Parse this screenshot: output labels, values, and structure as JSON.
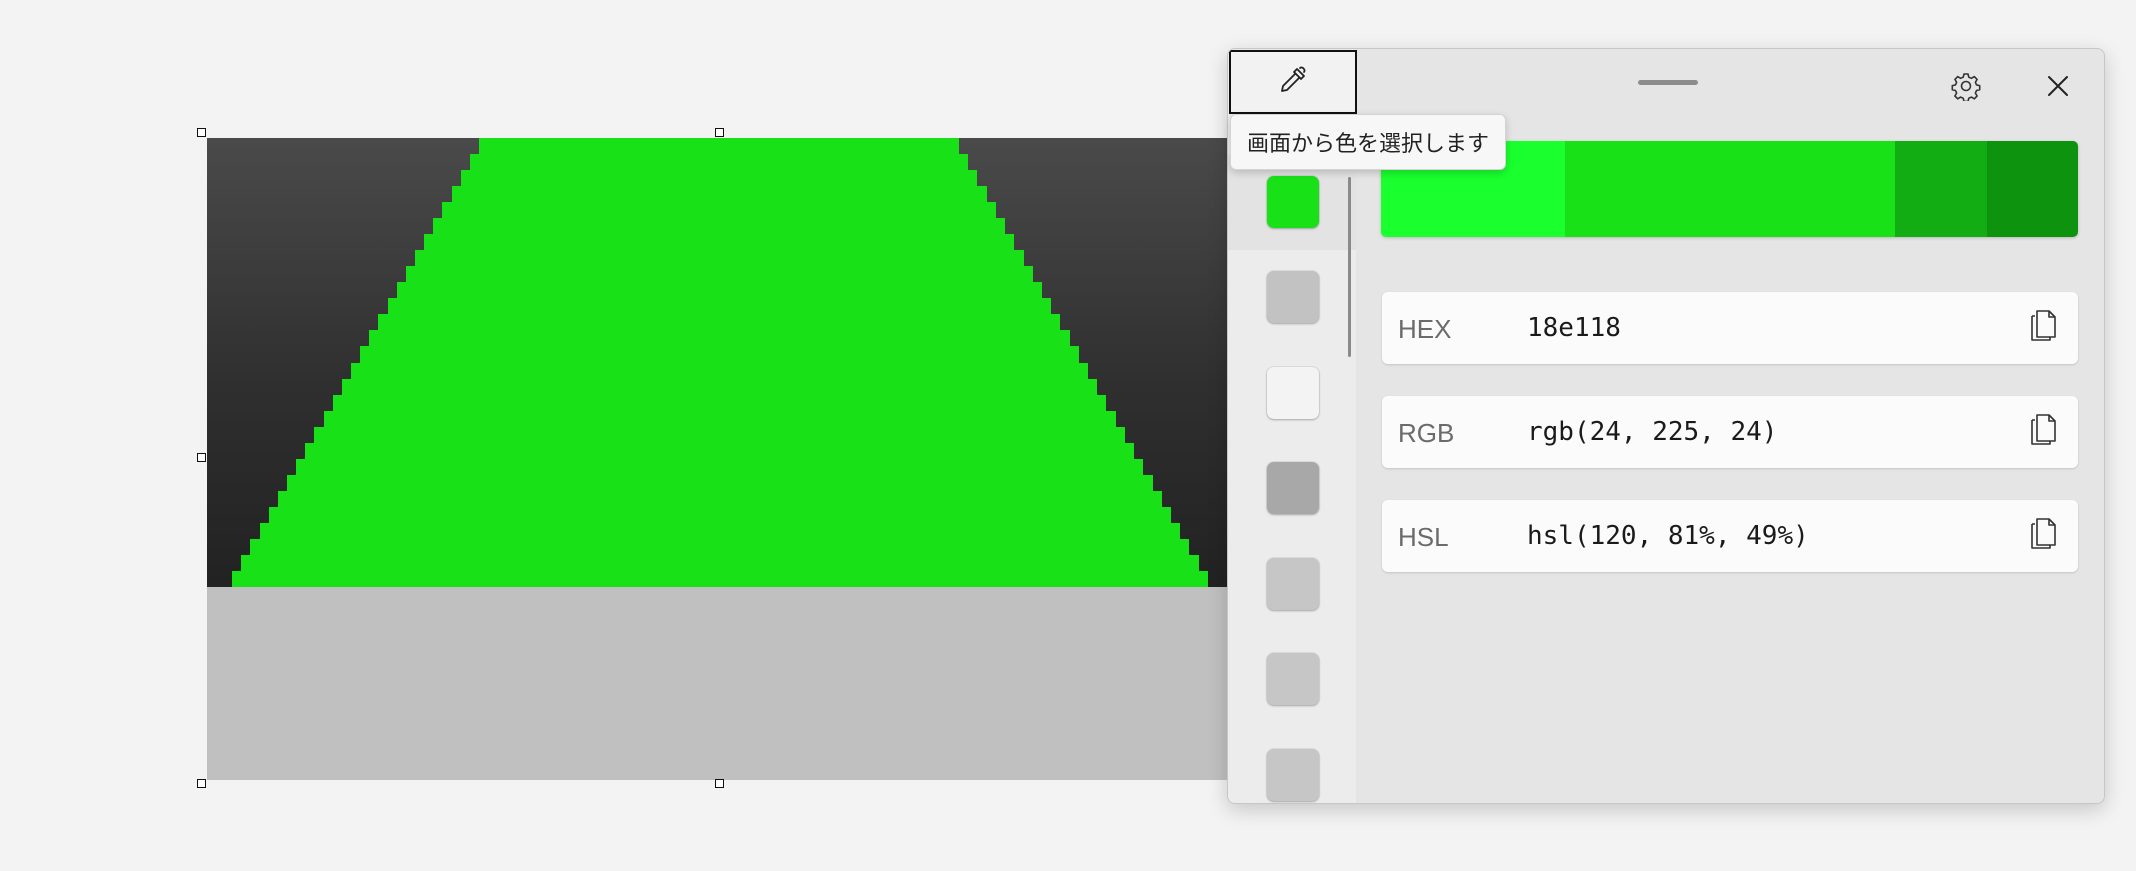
{
  "window": {
    "picker_button": "eyedropper-icon",
    "settings_icon": "gear-icon",
    "close_icon": "close-icon",
    "tooltip": "画面から色を選択します"
  },
  "history_swatches": [
    {
      "color": "#18e118",
      "selected": true
    },
    {
      "color": "#c2c2c2",
      "selected": false
    },
    {
      "color": "#f3f3f3",
      "selected": false
    },
    {
      "color": "#a8a8a8",
      "selected": false
    },
    {
      "color": "#c6c6c6",
      "selected": false
    },
    {
      "color": "#c6c6c6",
      "selected": false
    },
    {
      "color": "#c6c6c6",
      "selected": false
    }
  ],
  "shade_bar": [
    "#1aff2e",
    "#18e118",
    "#12ad12",
    "#0e930e"
  ],
  "formats": [
    {
      "label": "HEX",
      "value": "18e118"
    },
    {
      "label": "RGB",
      "value": "rgb(24, 225, 24)"
    },
    {
      "label": "HSL",
      "value": "hsl(120, 81%, 49%)"
    }
  ],
  "colors": {
    "background_image_green": "#18e118",
    "background_image_gray": "#c0c0c0"
  }
}
